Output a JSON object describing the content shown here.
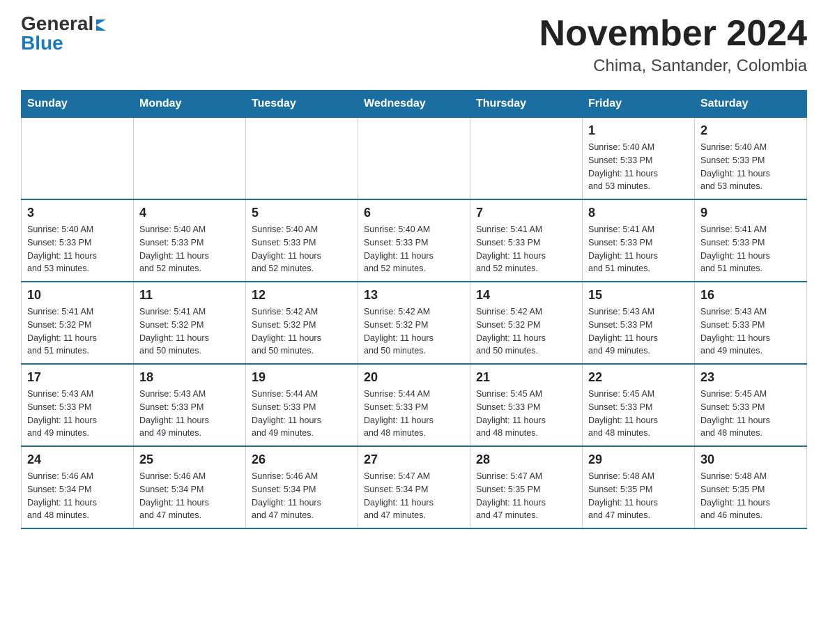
{
  "logo": {
    "general": "General",
    "blue": "Blue"
  },
  "title": "November 2024",
  "subtitle": "Chima, Santander, Colombia",
  "days_of_week": [
    "Sunday",
    "Monday",
    "Tuesday",
    "Wednesday",
    "Thursday",
    "Friday",
    "Saturday"
  ],
  "weeks": [
    [
      {
        "day": "",
        "info": ""
      },
      {
        "day": "",
        "info": ""
      },
      {
        "day": "",
        "info": ""
      },
      {
        "day": "",
        "info": ""
      },
      {
        "day": "",
        "info": ""
      },
      {
        "day": "1",
        "info": "Sunrise: 5:40 AM\nSunset: 5:33 PM\nDaylight: 11 hours\nand 53 minutes."
      },
      {
        "day": "2",
        "info": "Sunrise: 5:40 AM\nSunset: 5:33 PM\nDaylight: 11 hours\nand 53 minutes."
      }
    ],
    [
      {
        "day": "3",
        "info": "Sunrise: 5:40 AM\nSunset: 5:33 PM\nDaylight: 11 hours\nand 53 minutes."
      },
      {
        "day": "4",
        "info": "Sunrise: 5:40 AM\nSunset: 5:33 PM\nDaylight: 11 hours\nand 52 minutes."
      },
      {
        "day": "5",
        "info": "Sunrise: 5:40 AM\nSunset: 5:33 PM\nDaylight: 11 hours\nand 52 minutes."
      },
      {
        "day": "6",
        "info": "Sunrise: 5:40 AM\nSunset: 5:33 PM\nDaylight: 11 hours\nand 52 minutes."
      },
      {
        "day": "7",
        "info": "Sunrise: 5:41 AM\nSunset: 5:33 PM\nDaylight: 11 hours\nand 52 minutes."
      },
      {
        "day": "8",
        "info": "Sunrise: 5:41 AM\nSunset: 5:33 PM\nDaylight: 11 hours\nand 51 minutes."
      },
      {
        "day": "9",
        "info": "Sunrise: 5:41 AM\nSunset: 5:33 PM\nDaylight: 11 hours\nand 51 minutes."
      }
    ],
    [
      {
        "day": "10",
        "info": "Sunrise: 5:41 AM\nSunset: 5:32 PM\nDaylight: 11 hours\nand 51 minutes."
      },
      {
        "day": "11",
        "info": "Sunrise: 5:41 AM\nSunset: 5:32 PM\nDaylight: 11 hours\nand 50 minutes."
      },
      {
        "day": "12",
        "info": "Sunrise: 5:42 AM\nSunset: 5:32 PM\nDaylight: 11 hours\nand 50 minutes."
      },
      {
        "day": "13",
        "info": "Sunrise: 5:42 AM\nSunset: 5:32 PM\nDaylight: 11 hours\nand 50 minutes."
      },
      {
        "day": "14",
        "info": "Sunrise: 5:42 AM\nSunset: 5:32 PM\nDaylight: 11 hours\nand 50 minutes."
      },
      {
        "day": "15",
        "info": "Sunrise: 5:43 AM\nSunset: 5:33 PM\nDaylight: 11 hours\nand 49 minutes."
      },
      {
        "day": "16",
        "info": "Sunrise: 5:43 AM\nSunset: 5:33 PM\nDaylight: 11 hours\nand 49 minutes."
      }
    ],
    [
      {
        "day": "17",
        "info": "Sunrise: 5:43 AM\nSunset: 5:33 PM\nDaylight: 11 hours\nand 49 minutes."
      },
      {
        "day": "18",
        "info": "Sunrise: 5:43 AM\nSunset: 5:33 PM\nDaylight: 11 hours\nand 49 minutes."
      },
      {
        "day": "19",
        "info": "Sunrise: 5:44 AM\nSunset: 5:33 PM\nDaylight: 11 hours\nand 49 minutes."
      },
      {
        "day": "20",
        "info": "Sunrise: 5:44 AM\nSunset: 5:33 PM\nDaylight: 11 hours\nand 48 minutes."
      },
      {
        "day": "21",
        "info": "Sunrise: 5:45 AM\nSunset: 5:33 PM\nDaylight: 11 hours\nand 48 minutes."
      },
      {
        "day": "22",
        "info": "Sunrise: 5:45 AM\nSunset: 5:33 PM\nDaylight: 11 hours\nand 48 minutes."
      },
      {
        "day": "23",
        "info": "Sunrise: 5:45 AM\nSunset: 5:33 PM\nDaylight: 11 hours\nand 48 minutes."
      }
    ],
    [
      {
        "day": "24",
        "info": "Sunrise: 5:46 AM\nSunset: 5:34 PM\nDaylight: 11 hours\nand 48 minutes."
      },
      {
        "day": "25",
        "info": "Sunrise: 5:46 AM\nSunset: 5:34 PM\nDaylight: 11 hours\nand 47 minutes."
      },
      {
        "day": "26",
        "info": "Sunrise: 5:46 AM\nSunset: 5:34 PM\nDaylight: 11 hours\nand 47 minutes."
      },
      {
        "day": "27",
        "info": "Sunrise: 5:47 AM\nSunset: 5:34 PM\nDaylight: 11 hours\nand 47 minutes."
      },
      {
        "day": "28",
        "info": "Sunrise: 5:47 AM\nSunset: 5:35 PM\nDaylight: 11 hours\nand 47 minutes."
      },
      {
        "day": "29",
        "info": "Sunrise: 5:48 AM\nSunset: 5:35 PM\nDaylight: 11 hours\nand 47 minutes."
      },
      {
        "day": "30",
        "info": "Sunrise: 5:48 AM\nSunset: 5:35 PM\nDaylight: 11 hours\nand 46 minutes."
      }
    ]
  ]
}
